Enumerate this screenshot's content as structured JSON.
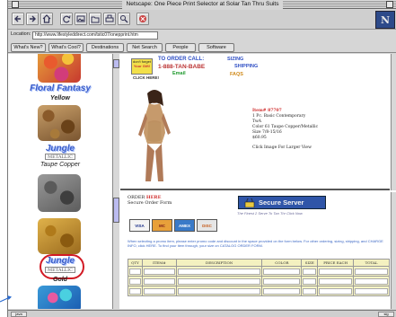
{
  "window": {
    "title": "Netscape: One Piece Print Selector at Solar Tan Thru Suits",
    "brand": "N"
  },
  "toolbar": {
    "buttons": [
      "back-icon",
      "forward-icon",
      "home-icon",
      "reload-icon",
      "images-icon",
      "open-icon",
      "print-icon",
      "find-icon",
      "stop-icon"
    ]
  },
  "location": {
    "label": "Location:",
    "url": "http://www.lifestyleddirect.com/tstic07/onepprint.htm"
  },
  "directory_buttons": [
    "What's New?",
    "What's Cool?",
    "Destinations",
    "Net Search",
    "People",
    "Software"
  ],
  "prints": [
    {
      "name": "Floral Fantasy",
      "color": "Yellow",
      "metallic": ""
    },
    {
      "name": "Jungle",
      "color": "Taupe Copper",
      "metallic": "METALLIC"
    },
    {
      "name": "Jungle",
      "color": "Gold",
      "metallic": "METALLIC"
    }
  ],
  "promo": {
    "badge_lines": [
      "don't forget",
      "Your Gift!"
    ],
    "click_here": "CLICK HERE!",
    "call_text": "TO ORDER CALL:",
    "phone": "1-888-TAN-BABE",
    "email": "Email",
    "nav": [
      "SIZING",
      "SHIPPING",
      "FAQS"
    ]
  },
  "product": {
    "code": "Item# 87707",
    "lines": [
      "1 Pc. Basic Contemporary",
      "TwA",
      "Color 61 Taupe Copper/Metallic",
      "Size 7/8-15/16",
      "$60.95"
    ],
    "hint": "Click Image For Larger View"
  },
  "order_form": {
    "title_prefix": "ORDER",
    "title_highlight": "HERE",
    "subtitle": "Secure Order Form",
    "secure_label": "Secure Server",
    "secure_note": "The Finest 2 Serve To Tan Thr   Click Now",
    "cards": [
      "VISA",
      "MC",
      "AMEX",
      "DISC"
    ],
    "instructions": "When selecting a promo item, please enter promo code and discount in the space provided on the form below. For other ordering, sizing, shipping, and CHARGE INFO, click HERE. To find your item through, your size on CATALOG ORDER FORM.",
    "columns": [
      "QTY",
      "ITEM#",
      "DESCRIPTION",
      "COLOR",
      "SIZE",
      "PRICE EACH",
      "TOTAL"
    ]
  },
  "status": {
    "left": "java",
    "right": "sig"
  },
  "colors": {
    "label_blue": "#3a5dc8",
    "ring_red": "#d21a24",
    "form_yellow": "#f7f4c4",
    "secure_blue": "#2f55a8"
  }
}
